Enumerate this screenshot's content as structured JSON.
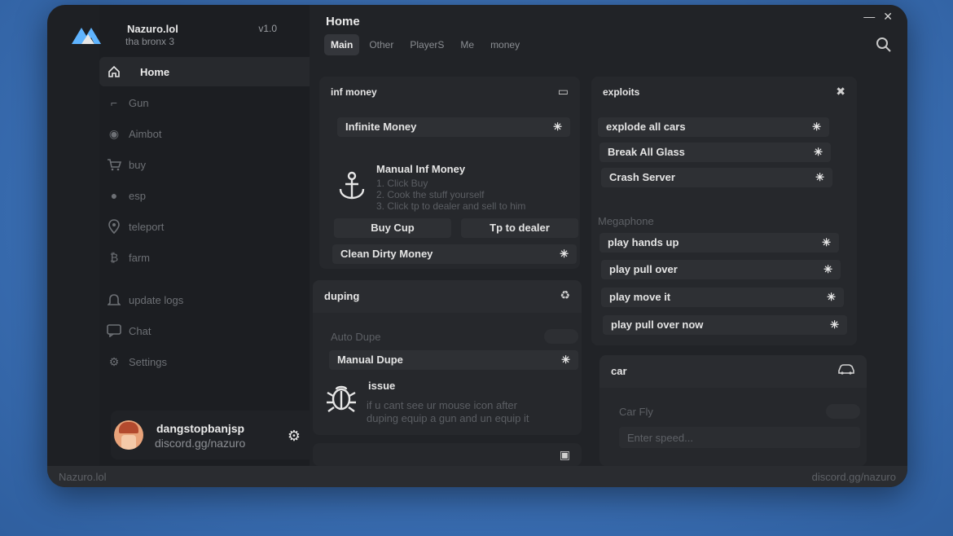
{
  "app": {
    "name": "Nazuro.lol",
    "subtitle": "tha bronx 3",
    "version": "v1.0"
  },
  "sidebar": {
    "items": [
      {
        "label": "Home",
        "icon": "home-icon",
        "active": true
      },
      {
        "label": "Gun",
        "icon": "gun-icon"
      },
      {
        "label": "Aimbot",
        "icon": "target-icon"
      },
      {
        "label": "buy",
        "icon": "cart-icon"
      },
      {
        "label": "esp",
        "icon": "chat-bubble-icon"
      },
      {
        "label": "teleport",
        "icon": "pin-icon"
      },
      {
        "label": "farm",
        "icon": "bitcoin-icon"
      }
    ],
    "extra_items": [
      {
        "label": "update logs",
        "icon": "bell-icon"
      },
      {
        "label": "Chat",
        "icon": "chat-icon"
      },
      {
        "label": "Settings",
        "icon": "settings-icon"
      }
    ],
    "user": {
      "name": "dangstopbanjsp",
      "discord": "discord.gg/nazuro"
    }
  },
  "header": {
    "title": "Home",
    "tabs": [
      {
        "label": "Main",
        "active": true
      },
      {
        "label": "Other"
      },
      {
        "label": "PlayerS"
      },
      {
        "label": "Me"
      },
      {
        "label": "money"
      }
    ]
  },
  "inf_money": {
    "title": "inf money",
    "infinite_money": "Infinite Money",
    "manual_title": "Manual Inf Money",
    "manual_steps": [
      "1. Click Buy",
      "2. Cook the stuff yourself",
      "3. Click tp to dealer and sell to him"
    ],
    "buy_cup": "Buy Cup",
    "tp_dealer": "Tp to dealer",
    "clean_money": "Clean Dirty Money"
  },
  "duping": {
    "title": "duping",
    "auto_dupe": "Auto Dupe",
    "manual_dupe": "Manual Dupe",
    "issue_title": "issue",
    "issue_lines": [
      "if u cant see ur mouse icon after",
      "duping equip a gun and un equip it"
    ]
  },
  "exploits": {
    "title": "exploits",
    "items": [
      "explode all cars",
      "Break All Glass",
      "Crash Server"
    ],
    "megaphone_label": "Megaphone",
    "megaphone_items": [
      "play hands up",
      "play pull over",
      "play move it",
      "play pull over now"
    ]
  },
  "car": {
    "title": "car",
    "car_fly": "Car Fly",
    "speed_placeholder": "Enter speed..."
  },
  "footer": {
    "left": "Nazuro.lol",
    "right": "discord.gg/nazuro"
  },
  "colors": {
    "window_bg": "#1e2024",
    "panel_bg": "#26282c",
    "row_bg": "#2e3034",
    "accent_text": "#e6e6e6"
  }
}
